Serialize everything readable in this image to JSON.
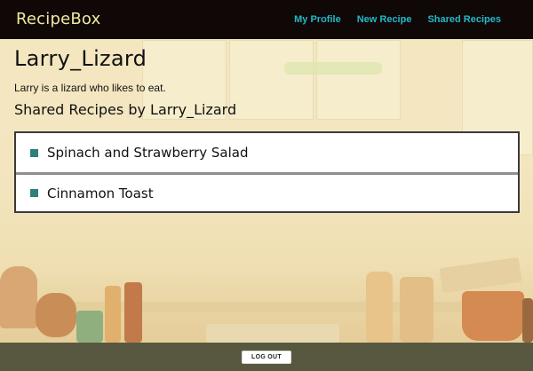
{
  "navbar": {
    "brand": "RecipeBox",
    "links": [
      "My Profile",
      "New Recipe",
      "Shared Recipes"
    ]
  },
  "profile": {
    "name": "Larry_Lizard",
    "bio": "Larry is a lizard who likes to eat.",
    "shared_heading": "Shared Recipes by Larry_Lizard"
  },
  "recipes": [
    {
      "title": "Spinach and Strawberry Salad"
    },
    {
      "title": "Cinnamon Toast"
    }
  ],
  "footer": {
    "logout_label": "LOG OUT"
  },
  "colors": {
    "navbar_bg": "#100807",
    "brand": "#f0e9a0",
    "nav_link": "#22b8c9",
    "bullet": "#2f7f7a",
    "footer_bg": "#585840"
  }
}
